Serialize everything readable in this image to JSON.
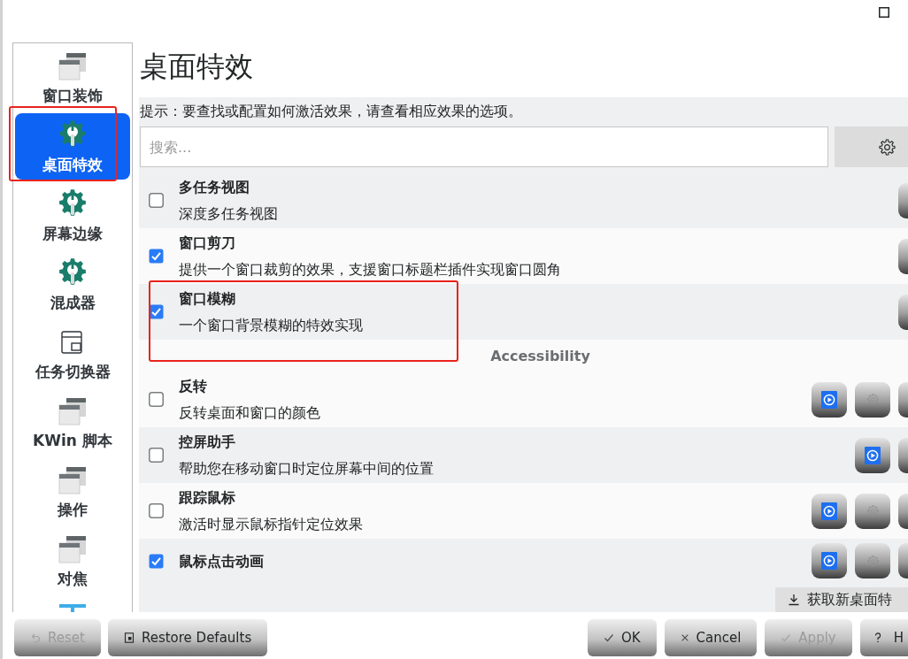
{
  "sidebar": {
    "items": [
      {
        "label": "窗口装饰",
        "kind": "decoration",
        "selected": false,
        "annotated": false
      },
      {
        "label": "桌面特效",
        "kind": "effects",
        "selected": true,
        "annotated": true
      },
      {
        "label": "屏幕边缘",
        "kind": "effects",
        "selected": false,
        "annotated": false
      },
      {
        "label": "混成器",
        "kind": "effects",
        "selected": false,
        "annotated": false
      },
      {
        "label": "任务切换器",
        "kind": "switcher",
        "selected": false,
        "annotated": false
      },
      {
        "label": "KWin 脚本",
        "kind": "decoration",
        "selected": false,
        "annotated": false
      },
      {
        "label": "操作",
        "kind": "decoration",
        "selected": false,
        "annotated": false
      },
      {
        "label": "对焦",
        "kind": "decoration",
        "selected": false,
        "annotated": false
      },
      {
        "kind": "partial",
        "selected": false,
        "annotated": false
      }
    ]
  },
  "page": {
    "title": "桌面特效",
    "hint": "提示：要查找或配置如何激活效果，请查看相应效果的选项。",
    "search": {
      "placeholder": "搜索..."
    }
  },
  "effect_groups": [
    {
      "effects": [
        {
          "name": "多任务视图",
          "description": "深度多任务视图",
          "checked": false,
          "annotated": false,
          "actions": [
            {
              "kind": "other"
            }
          ]
        },
        {
          "name": "窗口剪刀",
          "description": "提供一个窗口裁剪的效果，支援窗口标题栏插件实现窗口圆角",
          "checked": true,
          "annotated": false,
          "actions": [
            {
              "kind": "other"
            }
          ]
        },
        {
          "name": "窗口模糊",
          "description": "一个窗口背景模糊的特效实现",
          "checked": true,
          "annotated": true,
          "actions": [
            {
              "kind": "other"
            }
          ]
        }
      ]
    },
    {
      "heading": "Accessibility",
      "effects": [
        {
          "name": "反转",
          "description": "反转桌面和窗口的颜色",
          "checked": false,
          "annotated": false,
          "actions": [
            {
              "kind": "video"
            },
            {
              "kind": "configure"
            },
            {
              "kind": "other"
            }
          ]
        },
        {
          "name": "控屏助手",
          "description": "帮助您在移动窗口时定位屏幕中间的位置",
          "checked": false,
          "annotated": false,
          "actions": [
            {
              "kind": "video"
            },
            {
              "kind": "other"
            }
          ]
        },
        {
          "name": "跟踪鼠标",
          "description": "激活时显示鼠标指针定位效果",
          "checked": false,
          "annotated": false,
          "actions": [
            {
              "kind": "video"
            },
            {
              "kind": "configure"
            },
            {
              "kind": "other"
            }
          ]
        },
        {
          "name": "鼠标点击动画",
          "checked": true,
          "annotated": false,
          "actions": [
            {
              "kind": "video"
            },
            {
              "kind": "configure"
            },
            {
              "kind": "other"
            }
          ]
        }
      ]
    }
  ],
  "get_new_button": {
    "label": "获取新桌面特"
  },
  "dialog_buttons": {
    "left": [
      {
        "label": "Reset",
        "kind": "reset",
        "disabled": true
      },
      {
        "label": "Restore Defaults",
        "kind": "defaults",
        "disabled": false
      }
    ],
    "right": [
      {
        "label": "OK",
        "kind": "ok",
        "disabled": false
      },
      {
        "label": "Cancel",
        "kind": "cancel",
        "disabled": false
      },
      {
        "label": "Apply",
        "kind": "apply",
        "disabled": true
      },
      {
        "label": "H",
        "kind": "help",
        "disabled": false
      }
    ]
  }
}
